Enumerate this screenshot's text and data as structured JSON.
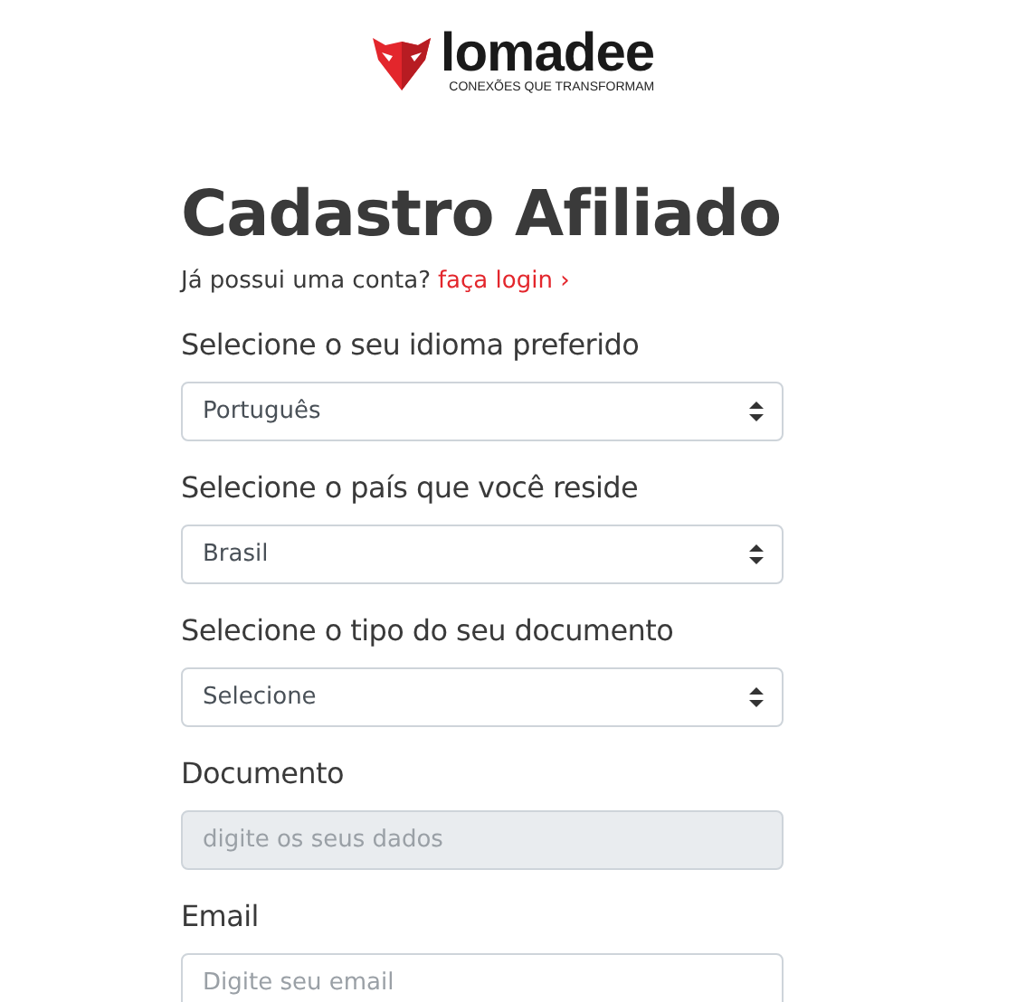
{
  "logo": {
    "name": "lomadee",
    "tagline": "CONEXÕES QUE TRANSFORMAM"
  },
  "title": "Cadastro Afiliado",
  "login_prompt": {
    "text": "Já possui uma conta?",
    "link": "faça login ›"
  },
  "fields": [
    {
      "kind": "select",
      "label": "Selecione o seu idioma preferido",
      "value": "Português"
    },
    {
      "kind": "select",
      "label": "Selecione o país que você reside",
      "value": "Brasil"
    },
    {
      "kind": "select",
      "label": "Selecione o tipo do seu documento",
      "value": "Selecione"
    },
    {
      "kind": "input",
      "label": "Documento",
      "placeholder": "digite os seus dados",
      "disabled": true
    },
    {
      "kind": "input",
      "label": "Email",
      "placeholder": "Digite seu email",
      "disabled": false
    }
  ]
}
